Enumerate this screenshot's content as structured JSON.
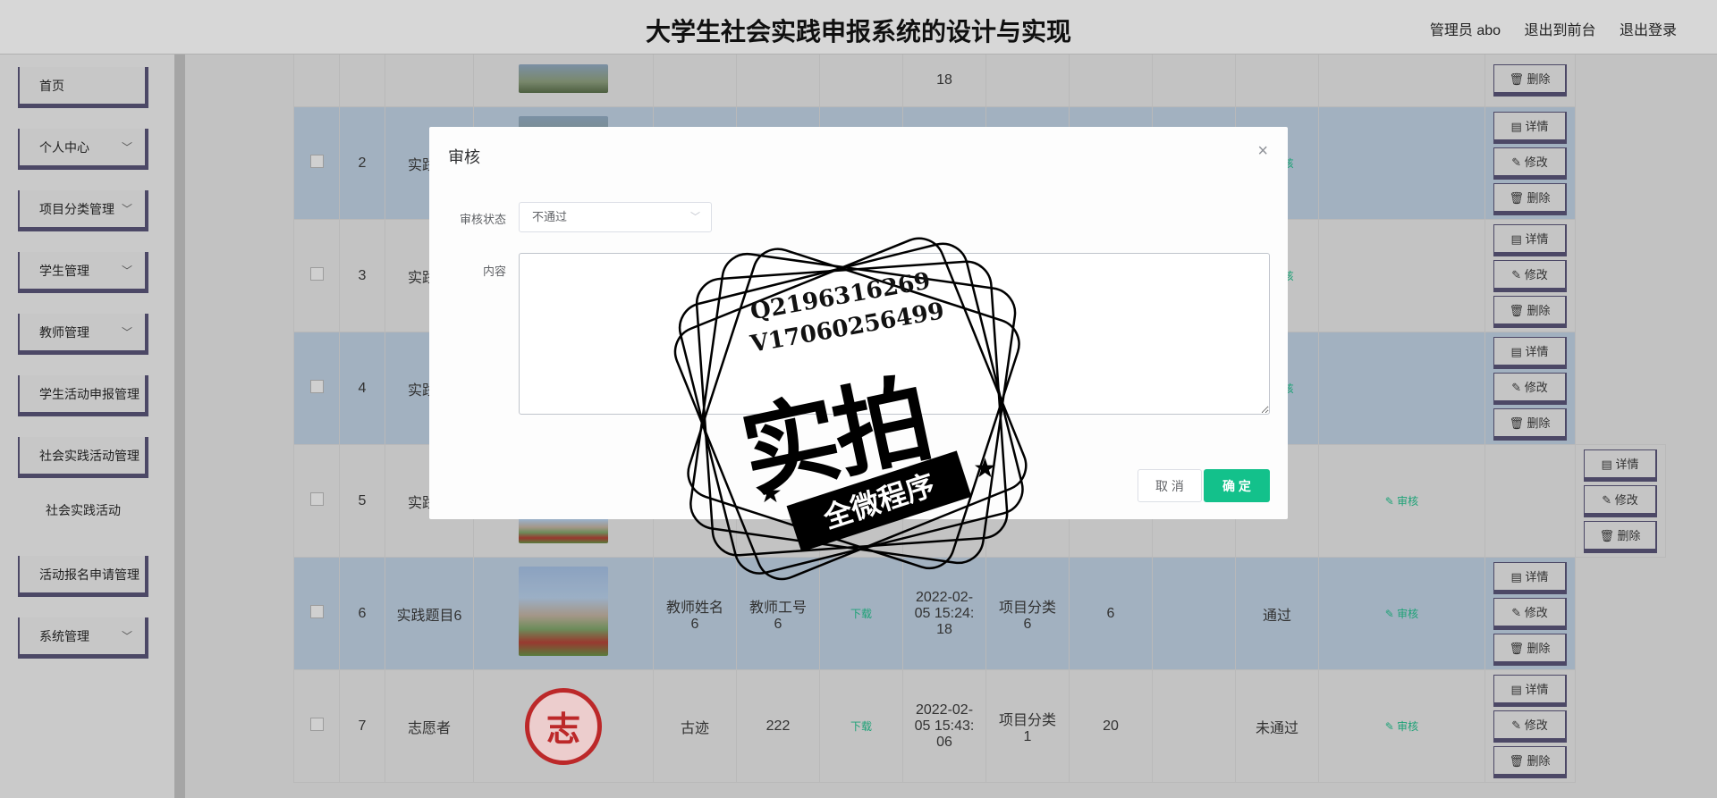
{
  "header": {
    "title": "大学生社会实践申报系统的设计与实现",
    "user": "管理员 abo",
    "back_front": "退出到前台",
    "logout": "退出登录"
  },
  "sidebar": {
    "items": [
      {
        "label": "首页"
      },
      {
        "label": "个人中心",
        "chevron": "﹀"
      },
      {
        "label": "项目分类管理",
        "chevron": "﹀"
      },
      {
        "label": "学生管理",
        "chevron": "﹀"
      },
      {
        "label": "教师管理",
        "chevron": "﹀"
      },
      {
        "label": "学生活动申报管理"
      },
      {
        "label": "社会实践活动管理"
      },
      {
        "label": "社会实践活动"
      },
      {
        "label": "活动报名申请管理"
      },
      {
        "label": "系统管理",
        "chevron": "﹀"
      }
    ]
  },
  "table": {
    "top_row": {
      "date_part": "18",
      "detail_btn": "🗑 删除"
    },
    "rows": [
      {
        "index": "2",
        "title": "实践是",
        "audit": "✎ 审核"
      },
      {
        "index": "3",
        "title": "实践是",
        "audit": "✎ 审核"
      },
      {
        "index": "4",
        "title": "实践是",
        "audit": "✎ 审核"
      },
      {
        "index": "5",
        "title": "实践是",
        "audit": "✎ 审核"
      },
      {
        "index": "6",
        "title": "实践题目6",
        "teacher": "教师姓名\n6",
        "teacher_no": "教师工号\n6",
        "download": "下载",
        "date": "2022-02-\n05 15:24:\n18",
        "category": "项目分类\n6",
        "count": "6",
        "status": "通过",
        "audit": "✎ 审核"
      },
      {
        "index": "7",
        "title": "志愿者",
        "teacher": "古迹",
        "teacher_no": "222",
        "download": "下载",
        "date": "2022-02-\n05 15:43:\n06",
        "category": "项目分类\n1",
        "count": "20",
        "status": "未通过",
        "audit": "✎ 审核"
      }
    ],
    "actions": {
      "detail": "▤ 详情",
      "edit": "✎ 修改",
      "delete": "🗑 删除"
    },
    "logo_text": "志"
  },
  "dialog": {
    "title": "审核",
    "close": "×",
    "status_label": "审核状态",
    "status_value": "不通过",
    "content_label": "内容",
    "cancel": "取 消",
    "confirm": "确 定"
  },
  "watermark": {
    "line1": "Q2196316269",
    "line2": "V17060256499",
    "big": "实拍",
    "ribbon": "全微程序"
  }
}
